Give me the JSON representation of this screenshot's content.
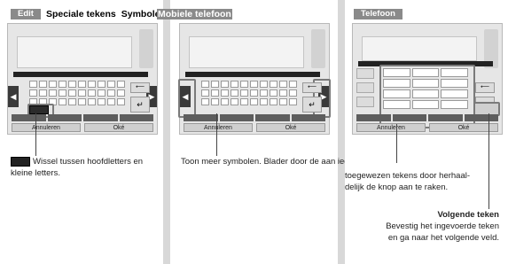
{
  "panel1": {
    "tab_edit": "Edit",
    "tab_special": "Speciale tekens",
    "tab_symbols": "Symbolen"
  },
  "panel2": {
    "tab_mobile": "Mobiele telefoon"
  },
  "panel3": {
    "tab_phone": "Telefoon"
  },
  "keyboard_bottom": {
    "cancel": "Annuleren",
    "ok": "Oké"
  },
  "captions": {
    "shift_line1": "Wissel tussen hoofdletters en",
    "shift_line2": "kleine letters.",
    "more_symbols": "Toon meer symbolen. Blader door de aan iedere knop",
    "assigned_line1": "toegewezen tekens door herhaal-",
    "assigned_line2": "delijk de knop aan te raken.",
    "next_title": "Volgende teken",
    "next_line1": "Bevestig het ingevoerde teken",
    "next_line2": "en ga naar het volgende veld."
  }
}
